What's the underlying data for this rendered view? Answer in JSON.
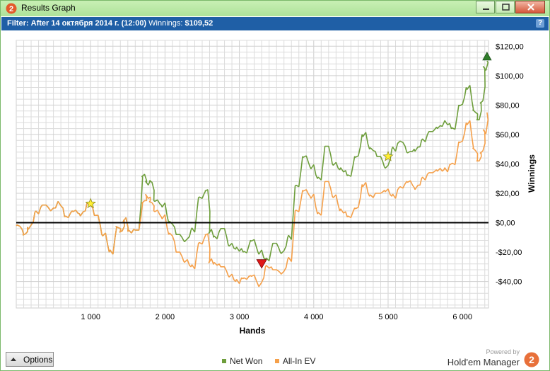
{
  "window": {
    "title": "Results Graph",
    "app_icon_glyph": "2"
  },
  "filter": {
    "label": "Filter:",
    "value": "After 14 октября 2014 г. (12:00)",
    "winnings_label": "Winnings:",
    "winnings_value": "$109,52",
    "help_glyph": "?"
  },
  "footer": {
    "options_label": "Options",
    "powered_by": "Powered by",
    "brand_name": "Hold'em Manager",
    "logo_glyph": "2"
  },
  "colors": {
    "net_won": "#6e9e3c",
    "all_in_ev": "#f5a04a",
    "grid": "#dcdcdc",
    "zero_line": "#000000",
    "filter_bar": "#1f5fa6",
    "title_bar": "#b8e8a4"
  },
  "chart_data": {
    "type": "line",
    "xlabel": "Hands",
    "ylabel": "Winnings",
    "xlim": [
      0,
      6350
    ],
    "ylim": [
      -58,
      124
    ],
    "x_ticks": [
      1000,
      2000,
      3000,
      4000,
      5000,
      6000
    ],
    "x_tick_labels": [
      "1 000",
      "2 000",
      "3 000",
      "4 000",
      "5 000",
      "6 000"
    ],
    "y_ticks": [
      -40,
      -20,
      0,
      20,
      40,
      60,
      80,
      100,
      120
    ],
    "y_tick_labels": [
      "-$40,00",
      "-$20,00",
      "$0,00",
      "$20,00",
      "$40,00",
      "$60,00",
      "$80,00",
      "$100,00",
      "$120,00"
    ],
    "grid": true,
    "series": [
      {
        "name": "Net Won",
        "color": "#6e9e3c",
        "x": [
          0,
          100,
          150,
          250,
          350,
          450,
          550,
          650,
          750,
          850,
          950,
          1050,
          1150,
          1250,
          1350,
          1400,
          1450,
          1500,
          1600,
          1700,
          1750,
          1800,
          1850,
          1950,
          2050,
          2150,
          2250,
          2350,
          2450,
          2550,
          2600,
          2650,
          2750,
          2850,
          2950,
          3050,
          3150,
          3250,
          3350,
          3450,
          3550,
          3650,
          3750,
          3850,
          3950,
          4050,
          4150,
          4250,
          4350,
          4450,
          4550,
          4650,
          4750,
          4850,
          4950,
          5050,
          5150,
          5250,
          5350,
          5450,
          5550,
          5650,
          5750,
          5850,
          5950,
          6050,
          6150,
          6200,
          6250,
          6300,
          6330
        ],
        "y": [
          -2,
          -8,
          -3,
          7,
          12,
          9,
          13,
          4,
          8,
          6,
          13,
          5,
          -8,
          -20,
          -3,
          -6,
          2,
          -6,
          -5,
          32,
          27,
          28,
          15,
          12,
          0,
          -8,
          -12,
          -5,
          17,
          22,
          -6,
          -10,
          -4,
          -15,
          -18,
          -20,
          -12,
          -20,
          -25,
          -14,
          -20,
          -10,
          25,
          45,
          38,
          30,
          52,
          40,
          36,
          32,
          45,
          60,
          50,
          45,
          38,
          50,
          55,
          48,
          50,
          56,
          62,
          65,
          68,
          64,
          80,
          92,
          76,
          70,
          82,
          105,
          110
        ]
      },
      {
        "name": "All-In EV",
        "color": "#f5a04a",
        "x": [
          0,
          100,
          150,
          250,
          350,
          450,
          550,
          650,
          750,
          850,
          950,
          1050,
          1150,
          1250,
          1350,
          1400,
          1450,
          1500,
          1600,
          1700,
          1750,
          1800,
          1850,
          1950,
          2050,
          2150,
          2250,
          2350,
          2450,
          2550,
          2600,
          2650,
          2750,
          2850,
          2950,
          3050,
          3150,
          3250,
          3350,
          3450,
          3550,
          3650,
          3750,
          3850,
          3950,
          4050,
          4150,
          4250,
          4350,
          4450,
          4550,
          4650,
          4750,
          4850,
          4950,
          5050,
          5150,
          5250,
          5350,
          5450,
          5550,
          5650,
          5750,
          5850,
          5950,
          6050,
          6150,
          6200,
          6250,
          6300,
          6330
        ],
        "y": [
          -2,
          -8,
          -3,
          7,
          12,
          9,
          13,
          4,
          8,
          6,
          13,
          5,
          -8,
          -20,
          -3,
          -6,
          2,
          -6,
          -5,
          14,
          18,
          14,
          8,
          4,
          -8,
          -20,
          -26,
          -30,
          -14,
          -8,
          -26,
          -28,
          -30,
          -36,
          -40,
          -38,
          -36,
          -42,
          -30,
          -32,
          -34,
          -25,
          8,
          22,
          18,
          6,
          28,
          18,
          8,
          4,
          10,
          26,
          18,
          20,
          22,
          18,
          24,
          28,
          24,
          30,
          34,
          36,
          36,
          40,
          55,
          68,
          50,
          42,
          48,
          62,
          75
        ]
      }
    ],
    "markers": [
      {
        "type": "star",
        "series": "Net Won",
        "x": 1000,
        "y": 13
      },
      {
        "type": "triangle-down",
        "series": "All-In EV",
        "x": 3300,
        "y": -28
      },
      {
        "type": "star",
        "series": "Net Won",
        "x": 5000,
        "y": 45
      },
      {
        "type": "triangle-up",
        "series": "Net Won",
        "x": 6330,
        "y": 113
      }
    ]
  }
}
